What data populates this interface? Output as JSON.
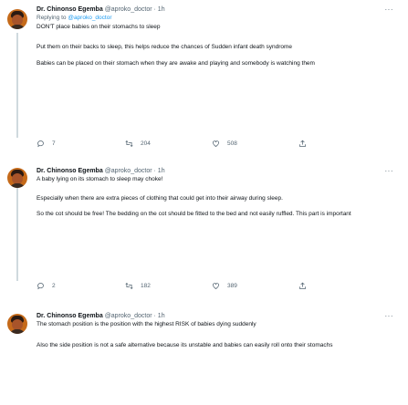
{
  "tweets": [
    {
      "name": "Dr. Chinonso Egemba",
      "handle": "@aproko_doctor",
      "separator": "·",
      "time": "1h",
      "replying_label": "Replying to",
      "replying_to": "@aproko_doctor",
      "paragraphs": [
        "DON'T place babies on their stomachs to sleep",
        "Put them on their backs to sleep, this helps reduce the chances of Sudden infant death syndrome",
        "Babies can be placed on their stomach when they are awake and playing and somebody is watching them"
      ],
      "replies": "7",
      "retweets": "204",
      "likes": "508"
    },
    {
      "name": "Dr. Chinonso Egemba",
      "handle": "@aproko_doctor",
      "separator": "·",
      "time": "1h",
      "paragraphs": [
        "A baby lying on its stomach to sleep may choke!",
        "Especially when there are extra pieces of clothing that could get into their airway during sleep.",
        "So the cot should be free! The bedding on the cot should be fitted to the bed and not easily ruffled. This part is important"
      ],
      "replies": "2",
      "retweets": "182",
      "likes": "389"
    },
    {
      "name": "Dr. Chinonso Egemba",
      "handle": "@aproko_doctor",
      "separator": "·",
      "time": "1h",
      "paragraphs": [
        "The stomach position is the position with the highest RISK of babies dying suddenly",
        "Also the side position is not a safe alternative because its unstable and babies can easily roll onto their stomachs"
      ]
    }
  ],
  "more_label": "···",
  "icons": [
    "reply-icon",
    "retweet-icon",
    "like-icon",
    "share-icon"
  ],
  "colors": {
    "link": "#1d9bf0",
    "muted": "#536471",
    "text": "#0f1419"
  }
}
